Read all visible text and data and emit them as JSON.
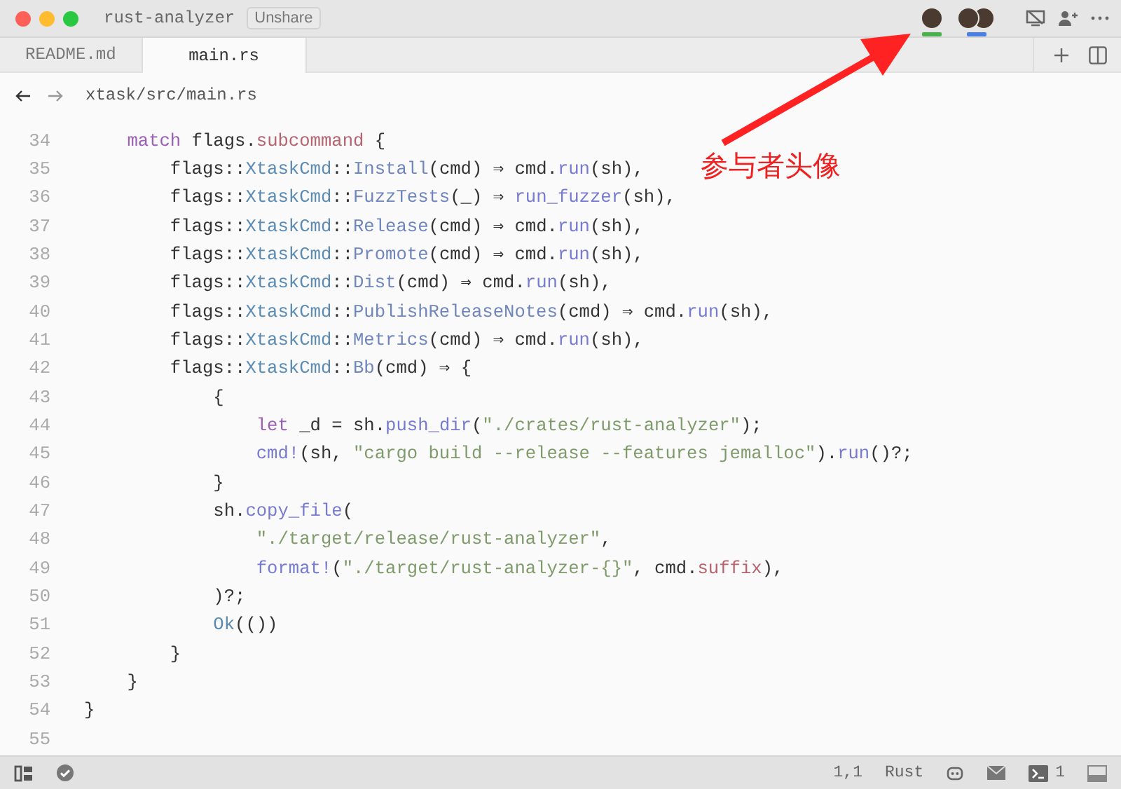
{
  "window": {
    "title": "rust-analyzer",
    "share_button": "Unshare"
  },
  "collaborators": [
    {
      "kind": "single",
      "color": "#4caf50"
    },
    {
      "kind": "pair",
      "color": "#4a7fe0"
    }
  ],
  "tabs": [
    {
      "label": "README.md",
      "selected": false
    },
    {
      "label": "main.rs",
      "selected": true
    }
  ],
  "breadcrumb": {
    "path": "xtask/src/main.rs"
  },
  "code_lines": [
    {
      "n": "34",
      "tokens": [
        {
          "kind": "keyword",
          "t": "    match"
        },
        {
          "kind": "plain",
          "t": " flags."
        },
        {
          "kind": "field",
          "t": "subcommand"
        },
        {
          "kind": "plain",
          "t": " {"
        }
      ]
    },
    {
      "n": "35",
      "tokens": [
        {
          "kind": "plain",
          "t": "        flags::"
        },
        {
          "kind": "type",
          "t": "XtaskCmd"
        },
        {
          "kind": "plain",
          "t": "::"
        },
        {
          "kind": "variant",
          "t": "Install"
        },
        {
          "kind": "plain",
          "t": "(cmd) ⇒ cmd."
        },
        {
          "kind": "func",
          "t": "run"
        },
        {
          "kind": "plain",
          "t": "(sh),"
        }
      ]
    },
    {
      "n": "36",
      "tokens": [
        {
          "kind": "plain",
          "t": "        flags::"
        },
        {
          "kind": "type",
          "t": "XtaskCmd"
        },
        {
          "kind": "plain",
          "t": "::"
        },
        {
          "kind": "variant",
          "t": "FuzzTests"
        },
        {
          "kind": "plain",
          "t": "(_) ⇒ "
        },
        {
          "kind": "func",
          "t": "run_fuzzer"
        },
        {
          "kind": "plain",
          "t": "(sh),"
        }
      ]
    },
    {
      "n": "37",
      "tokens": [
        {
          "kind": "plain",
          "t": "        flags::"
        },
        {
          "kind": "type",
          "t": "XtaskCmd"
        },
        {
          "kind": "plain",
          "t": "::"
        },
        {
          "kind": "variant",
          "t": "Release"
        },
        {
          "kind": "plain",
          "t": "(cmd) ⇒ cmd."
        },
        {
          "kind": "func",
          "t": "run"
        },
        {
          "kind": "plain",
          "t": "(sh),"
        }
      ]
    },
    {
      "n": "38",
      "tokens": [
        {
          "kind": "plain",
          "t": "        flags::"
        },
        {
          "kind": "type",
          "t": "XtaskCmd"
        },
        {
          "kind": "plain",
          "t": "::"
        },
        {
          "kind": "variant",
          "t": "Promote"
        },
        {
          "kind": "plain",
          "t": "(cmd) ⇒ cmd."
        },
        {
          "kind": "func",
          "t": "run"
        },
        {
          "kind": "plain",
          "t": "(sh),"
        }
      ]
    },
    {
      "n": "39",
      "tokens": [
        {
          "kind": "plain",
          "t": "        flags::"
        },
        {
          "kind": "type",
          "t": "XtaskCmd"
        },
        {
          "kind": "plain",
          "t": "::"
        },
        {
          "kind": "variant",
          "t": "Dist"
        },
        {
          "kind": "plain",
          "t": "(cmd) ⇒ cmd."
        },
        {
          "kind": "func",
          "t": "run"
        },
        {
          "kind": "plain",
          "t": "(sh),"
        }
      ]
    },
    {
      "n": "40",
      "tokens": [
        {
          "kind": "plain",
          "t": "        flags::"
        },
        {
          "kind": "type",
          "t": "XtaskCmd"
        },
        {
          "kind": "plain",
          "t": "::"
        },
        {
          "kind": "variant",
          "t": "PublishReleaseNotes"
        },
        {
          "kind": "plain",
          "t": "(cmd) ⇒ cmd."
        },
        {
          "kind": "func",
          "t": "run"
        },
        {
          "kind": "plain",
          "t": "(sh),"
        }
      ]
    },
    {
      "n": "41",
      "tokens": [
        {
          "kind": "plain",
          "t": "        flags::"
        },
        {
          "kind": "type",
          "t": "XtaskCmd"
        },
        {
          "kind": "plain",
          "t": "::"
        },
        {
          "kind": "variant",
          "t": "Metrics"
        },
        {
          "kind": "plain",
          "t": "(cmd) ⇒ cmd."
        },
        {
          "kind": "func",
          "t": "run"
        },
        {
          "kind": "plain",
          "t": "(sh),"
        }
      ]
    },
    {
      "n": "42",
      "tokens": [
        {
          "kind": "plain",
          "t": "        flags::"
        },
        {
          "kind": "type",
          "t": "XtaskCmd"
        },
        {
          "kind": "plain",
          "t": "::"
        },
        {
          "kind": "variant",
          "t": "Bb"
        },
        {
          "kind": "plain",
          "t": "(cmd) ⇒ {"
        }
      ]
    },
    {
      "n": "43",
      "tokens": [
        {
          "kind": "plain",
          "t": "            {"
        }
      ]
    },
    {
      "n": "44",
      "tokens": [
        {
          "kind": "keyword",
          "t": "                let"
        },
        {
          "kind": "plain",
          "t": " _d = sh."
        },
        {
          "kind": "func",
          "t": "push_dir"
        },
        {
          "kind": "plain",
          "t": "("
        },
        {
          "kind": "string",
          "t": "\"./crates/rust-analyzer\""
        },
        {
          "kind": "plain",
          "t": ");"
        }
      ]
    },
    {
      "n": "45",
      "tokens": [
        {
          "kind": "func",
          "t": "                cmd!"
        },
        {
          "kind": "plain",
          "t": "(sh, "
        },
        {
          "kind": "string",
          "t": "\"cargo build --release --features jemalloc\""
        },
        {
          "kind": "plain",
          "t": ")."
        },
        {
          "kind": "func",
          "t": "run"
        },
        {
          "kind": "plain",
          "t": "()?;"
        }
      ]
    },
    {
      "n": "46",
      "tokens": [
        {
          "kind": "plain",
          "t": "            }"
        }
      ]
    },
    {
      "n": "47",
      "tokens": [
        {
          "kind": "plain",
          "t": "            sh."
        },
        {
          "kind": "func",
          "t": "copy_file"
        },
        {
          "kind": "plain",
          "t": "("
        }
      ]
    },
    {
      "n": "48",
      "tokens": [
        {
          "kind": "string",
          "t": "                \"./target/release/rust-analyzer\""
        },
        {
          "kind": "plain",
          "t": ","
        }
      ]
    },
    {
      "n": "49",
      "tokens": [
        {
          "kind": "func",
          "t": "                format!"
        },
        {
          "kind": "plain",
          "t": "("
        },
        {
          "kind": "string",
          "t": "\"./target/rust-analyzer-{}\""
        },
        {
          "kind": "plain",
          "t": ", cmd."
        },
        {
          "kind": "field",
          "t": "suffix"
        },
        {
          "kind": "plain",
          "t": "),"
        }
      ]
    },
    {
      "n": "50",
      "tokens": [
        {
          "kind": "plain",
          "t": "            )?;"
        }
      ]
    },
    {
      "n": "51",
      "tokens": [
        {
          "kind": "type",
          "t": "            Ok"
        },
        {
          "kind": "plain",
          "t": "(())"
        }
      ]
    },
    {
      "n": "52",
      "tokens": [
        {
          "kind": "plain",
          "t": "        }"
        }
      ]
    },
    {
      "n": "53",
      "tokens": [
        {
          "kind": "plain",
          "t": "    }"
        }
      ]
    },
    {
      "n": "54",
      "tokens": [
        {
          "kind": "plain",
          "t": "}"
        }
      ]
    },
    {
      "n": "55"
    }
  ],
  "status_bar": {
    "cursor": "1,1",
    "language": "Rust",
    "terminal_count": "1"
  },
  "annotation": {
    "text": "参与者头像"
  }
}
